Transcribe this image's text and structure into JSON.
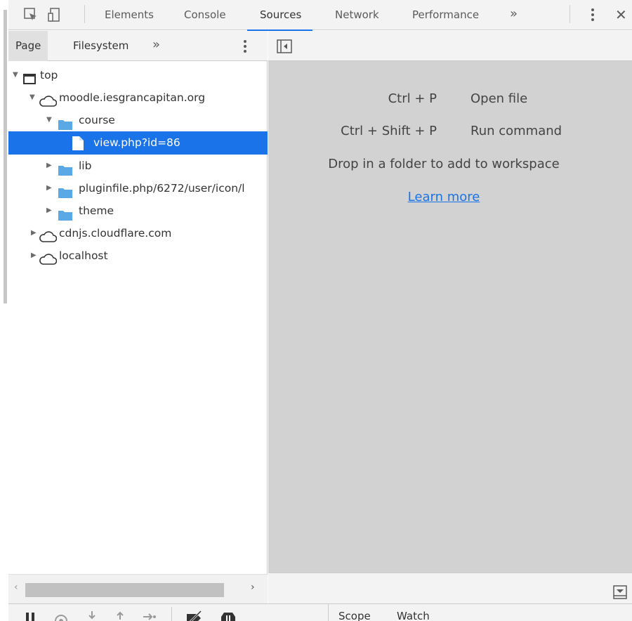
{
  "toolbar": {
    "tabs": [
      "Elements",
      "Console",
      "Sources",
      "Network",
      "Performance"
    ],
    "active_tab": "Sources",
    "overflow": "»",
    "close": "✕"
  },
  "navigator": {
    "tabs": [
      "Page",
      "Filesystem"
    ],
    "active_tab": "Page",
    "more": "»",
    "tree": [
      {
        "label": "top",
        "icon": "frame-icon",
        "expanded": true
      },
      {
        "label": "moodle.iesgrancapitan.org",
        "icon": "cloud-icon",
        "expanded": true
      },
      {
        "label": "course",
        "icon": "folder-icon",
        "expanded": true
      },
      {
        "label": "view.php?id=86",
        "icon": "file-icon",
        "selected": true
      },
      {
        "label": "lib",
        "icon": "folder-icon",
        "expanded": false
      },
      {
        "label": "pluginfile.php/6272/user/icon/l",
        "icon": "folder-icon",
        "expanded": false
      },
      {
        "label": "theme",
        "icon": "folder-icon",
        "expanded": false
      },
      {
        "label": "cdnjs.cloudflare.com",
        "icon": "cloud-icon",
        "expanded": false
      },
      {
        "label": "localhost",
        "icon": "cloud-icon",
        "expanded": false
      }
    ]
  },
  "editor": {
    "shortcuts": [
      {
        "key": "Ctrl + P",
        "desc": "Open file"
      },
      {
        "key": "Ctrl + Shift + P",
        "desc": "Run command"
      }
    ],
    "drop_text": "Drop in a folder to add to workspace",
    "learn_more": "Learn more"
  },
  "debugger": {
    "tabs": [
      "Scope",
      "Watch"
    ]
  },
  "colors": {
    "accent": "#1a73e8",
    "folder": "#5aa9e6",
    "editor_bg": "#d2d2d2",
    "toolbar_bg": "#f3f3f3"
  }
}
